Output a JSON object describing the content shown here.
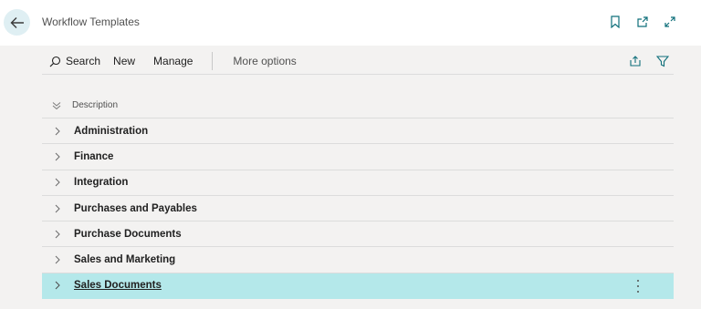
{
  "header": {
    "title": "Workflow Templates",
    "back_icon": "arrow-left-icon",
    "actions": [
      "bookmark-icon",
      "open-in-new-icon",
      "expand-icon"
    ]
  },
  "toolbar": {
    "search_label": "Search",
    "new_label": "New",
    "manage_label": "Manage",
    "more_label": "More options",
    "right_icons": [
      "share-icon",
      "filter-icon"
    ]
  },
  "list": {
    "column_header": "Description",
    "rows": [
      {
        "label": "Administration",
        "selected": false
      },
      {
        "label": "Finance",
        "selected": false
      },
      {
        "label": "Integration",
        "selected": false
      },
      {
        "label": "Purchases and Payables",
        "selected": false
      },
      {
        "label": "Purchase Documents",
        "selected": false
      },
      {
        "label": "Sales and Marketing",
        "selected": false
      },
      {
        "label": "Sales Documents",
        "selected": true
      }
    ]
  },
  "colors": {
    "selected_row": "#b4e8ea",
    "accent": "#0f6f7a"
  }
}
